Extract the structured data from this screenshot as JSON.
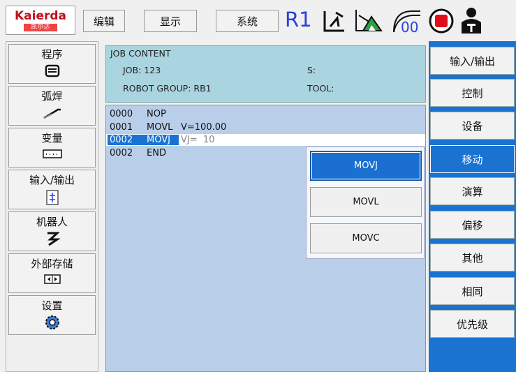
{
  "topbar": {
    "logo_en": "Kaierda",
    "logo_cn": "凯尔达",
    "menu": [
      "编辑",
      "显示",
      "系统"
    ],
    "robot_id": "R1",
    "icons": [
      "robot-arm-icon",
      "speed-gauge-icon",
      "teach-mode-icon",
      "stop-icon",
      "servo-on-icon",
      "operator-icon"
    ],
    "accent_color": "#2a40d8"
  },
  "sidebar": {
    "items": [
      {
        "label": "程序",
        "icon": "program-icon"
      },
      {
        "label": "弧焊",
        "icon": "arc-weld-icon"
      },
      {
        "label": "变量",
        "icon": "variable-icon"
      },
      {
        "label": "输入/输出",
        "icon": "io-icon"
      },
      {
        "label": "机器人",
        "icon": "robot-icon"
      },
      {
        "label": "外部存储",
        "icon": "storage-icon"
      },
      {
        "label": "设置",
        "icon": "settings-gear-icon"
      }
    ]
  },
  "job": {
    "title": "JOB CONTENT",
    "job_label": "JOB: 123",
    "group_label": "ROBOT GROUP: RB1",
    "s_label": "S:",
    "tool_label": "TOOL:"
  },
  "program": {
    "lines": [
      {
        "num": "0000",
        "cmd": "NOP",
        "arg": ""
      },
      {
        "num": "0001",
        "cmd": "MOVL",
        "arg": "V=100.00"
      },
      {
        "num": "0002",
        "cmd": "MOVJ",
        "arg": "VJ=  10"
      },
      {
        "num": "0002",
        "cmd": "END",
        "arg": ""
      }
    ]
  },
  "popup": {
    "items": [
      "MOVJ",
      "MOVL",
      "MOVC"
    ],
    "selected": "MOVJ"
  },
  "right": {
    "items": [
      "输入/输出",
      "控制",
      "设备",
      "移动",
      "演算",
      "偏移",
      "其他",
      "相同",
      "优先级"
    ],
    "active": "移动",
    "panel_color": "#1a73d0"
  }
}
